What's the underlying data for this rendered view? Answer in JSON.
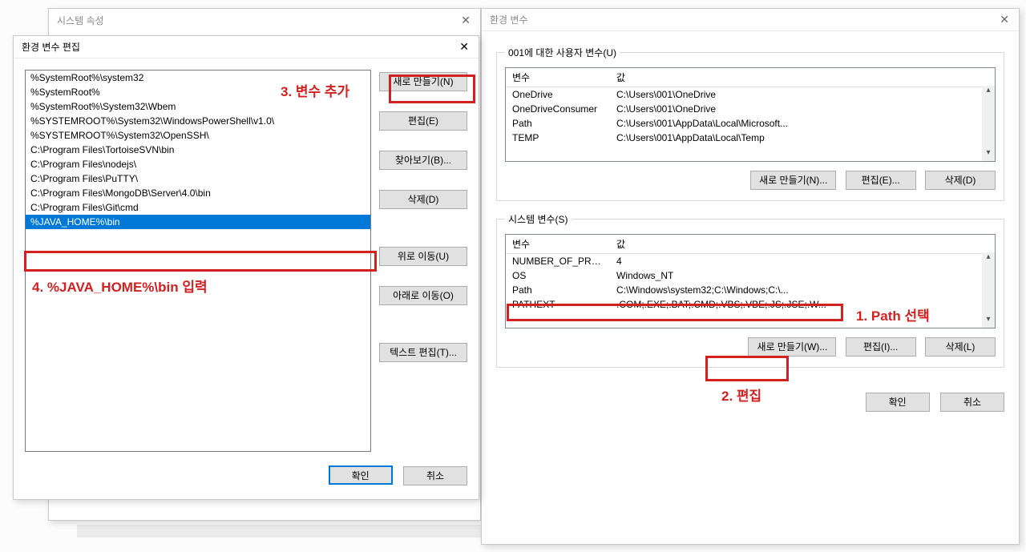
{
  "sysprop": {
    "title": "시스템 속성"
  },
  "envvars": {
    "title": "환경 변수",
    "userGroupLabel": "001에 대한 사용자 변수(U)",
    "systemGroupLabel": "시스템 변수(S)",
    "headers": {
      "var": "변수",
      "val": "값"
    },
    "userVars": [
      {
        "name": "OneDrive",
        "value": "C:\\Users\\001\\OneDrive"
      },
      {
        "name": "OneDriveConsumer",
        "value": "C:\\Users\\001\\OneDrive"
      },
      {
        "name": "Path",
        "value": "C:\\Users\\001\\AppData\\Local\\Microsoft..."
      },
      {
        "name": "TEMP",
        "value": "C:\\Users\\001\\AppData\\Local\\Temp"
      }
    ],
    "systemVars": [
      {
        "name": "NUMBER_OF_PRO...",
        "value": "4"
      },
      {
        "name": "OS",
        "value": "Windows_NT"
      },
      {
        "name": "Path",
        "value": "C:\\Windows\\system32;C:\\Windows;C:\\..."
      },
      {
        "name": "PATHEXT",
        "value": ".COM;.EXE;.BAT;.CMD;.VBS;.VBE;.JS;.JSE;.W..."
      }
    ],
    "buttons": {
      "userNew": "새로 만들기(N)...",
      "userEdit": "편집(E)...",
      "userDelete": "삭제(D)",
      "sysNew": "새로 만들기(W)...",
      "sysEdit": "편집(I)...",
      "sysDelete": "삭제(L)",
      "ok": "확인",
      "cancel": "취소"
    }
  },
  "editenv": {
    "title": "환경 변수 편집",
    "paths": [
      "%SystemRoot%\\system32",
      "%SystemRoot%",
      "%SystemRoot%\\System32\\Wbem",
      "%SYSTEMROOT%\\System32\\WindowsPowerShell\\v1.0\\",
      "%SYSTEMROOT%\\System32\\OpenSSH\\",
      "C:\\Program Files\\TortoiseSVN\\bin",
      "C:\\Program Files\\nodejs\\",
      "C:\\Program Files\\PuTTY\\",
      "C:\\Program Files\\MongoDB\\Server\\4.0\\bin",
      "C:\\Program Files\\Git\\cmd",
      "%JAVA_HOME%\\bin"
    ],
    "selectedIndex": 10,
    "buttons": {
      "new": "새로 만들기(N)",
      "edit": "편집(E)",
      "browse": "찾아보기(B)...",
      "delete": "삭제(D)",
      "moveUp": "위로 이동(U)",
      "moveDown": "아래로 이동(O)",
      "textEdit": "텍스트 편집(T)...",
      "ok": "확인",
      "cancel": "취소"
    }
  },
  "annotations": {
    "a1": "1. Path 선택",
    "a2": "2. 편집",
    "a3": "3. 변수 추가",
    "a4": "4. %JAVA_HOME%\\bin 입력"
  }
}
